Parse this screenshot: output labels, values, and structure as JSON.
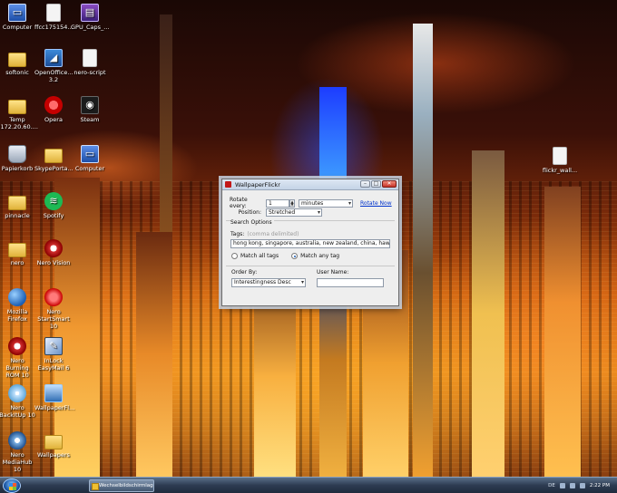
{
  "desktop": {
    "icons": [
      {
        "label": "Computer",
        "icon": "computer-icon"
      },
      {
        "label": "ffcc175154...",
        "icon": "document-icon"
      },
      {
        "label": "GPU_Caps_...",
        "icon": "archive-icon"
      },
      {
        "label": "softonic",
        "icon": "folder-icon"
      },
      {
        "label": "OpenOffice... 3.2",
        "icon": "openoffice-icon"
      },
      {
        "label": "nero-script",
        "icon": "document-icon"
      },
      {
        "label": "Temp (172.20.60....",
        "icon": "folder-icon"
      },
      {
        "label": "Opera",
        "icon": "opera-icon"
      },
      {
        "label": "Steam",
        "icon": "steam-icon"
      },
      {
        "label": "Papierkorb",
        "icon": "recycle-bin-icon"
      },
      {
        "label": "SkypePorta...",
        "icon": "folder-icon"
      },
      {
        "label": "Computer",
        "icon": "computer-icon"
      },
      {
        "label": "pinnacle",
        "icon": "folder-icon"
      },
      {
        "label": "Spotify",
        "icon": "spotify-icon"
      },
      {
        "label": "nero",
        "icon": "folder-icon"
      },
      {
        "label": "Nero Vision",
        "icon": "nero-icon"
      },
      {
        "label": "Mozilla Firefox",
        "icon": "firefox-icon"
      },
      {
        "label": "Nero StartSmart 10",
        "icon": "nero-icon"
      },
      {
        "label": "Nero Burning ROM 10",
        "icon": "nero-icon"
      },
      {
        "label": "InLock EasyMail 6",
        "icon": "pen-icon"
      },
      {
        "label": "Nero BackItUp 10",
        "icon": "disc-icon"
      },
      {
        "label": "WallpaperFl...",
        "icon": "wallpaper-icon"
      },
      {
        "label": "Nero MediaHub 10",
        "icon": "media-icon"
      },
      {
        "label": "Wallpapers",
        "icon": "folder-icon"
      },
      {
        "label": "flickr_wall...",
        "icon": "document-icon"
      }
    ]
  },
  "dialog": {
    "title": "WallpaperFlickr",
    "minimize": "–",
    "maximize": "□",
    "close": "✕",
    "rotate_label": "Rotate every:",
    "rotate_value": "1",
    "rotate_unit": "minutes",
    "rotate_now": "Rotate Now",
    "position_label": "Position:",
    "position_value": "Stretched",
    "search_section": "Search Options",
    "tags_label": "Tags:",
    "tags_hint": "(comma delimited)",
    "tags_value": "hong kong, singapore, australia, new zealand, china, hawaii",
    "match_all": "Match all tags",
    "match_any": "Match any tag",
    "order_label": "Order By:",
    "order_value": "Interestingness Desc",
    "username_label": "User Name:",
    "username_value": ""
  },
  "taskbar": {
    "task_label": "Wechselbildschirmlager...",
    "language": "DE",
    "clock": "2:22 PM"
  }
}
